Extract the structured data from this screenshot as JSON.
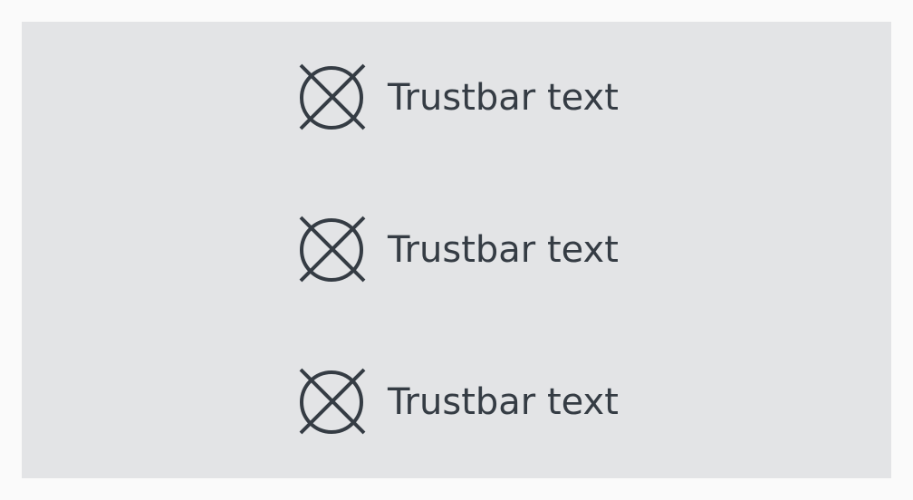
{
  "trustbar": {
    "items": [
      {
        "icon": "placeholder-image-icon",
        "label": "Trustbar text"
      },
      {
        "icon": "placeholder-image-icon",
        "label": "Trustbar text"
      },
      {
        "icon": "placeholder-image-icon",
        "label": "Trustbar text"
      }
    ]
  },
  "colors": {
    "background": "#fafafa",
    "bar_background": "#e3e4e6",
    "foreground": "#353c44"
  }
}
